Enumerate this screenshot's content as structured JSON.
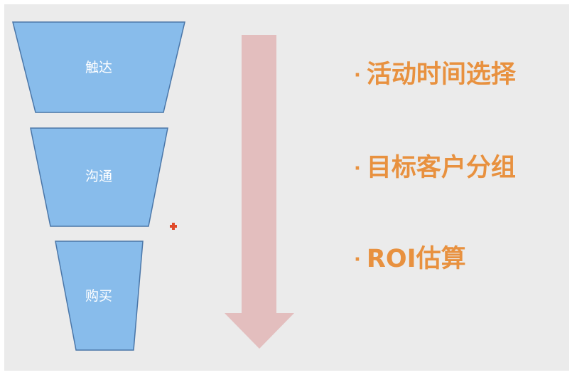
{
  "funnel": {
    "stages": [
      "触达",
      "沟通",
      "购买"
    ],
    "fill": "#88bceb",
    "stroke": "#4a76a8"
  },
  "arrow": {
    "fill": "#e3bebe"
  },
  "marker": {
    "fill": "#e04a2a"
  },
  "bullets": {
    "marker": "·",
    "items": [
      "活动时间选择",
      "目标客户分组",
      "ROI估算"
    ],
    "color": "#e8913f"
  }
}
